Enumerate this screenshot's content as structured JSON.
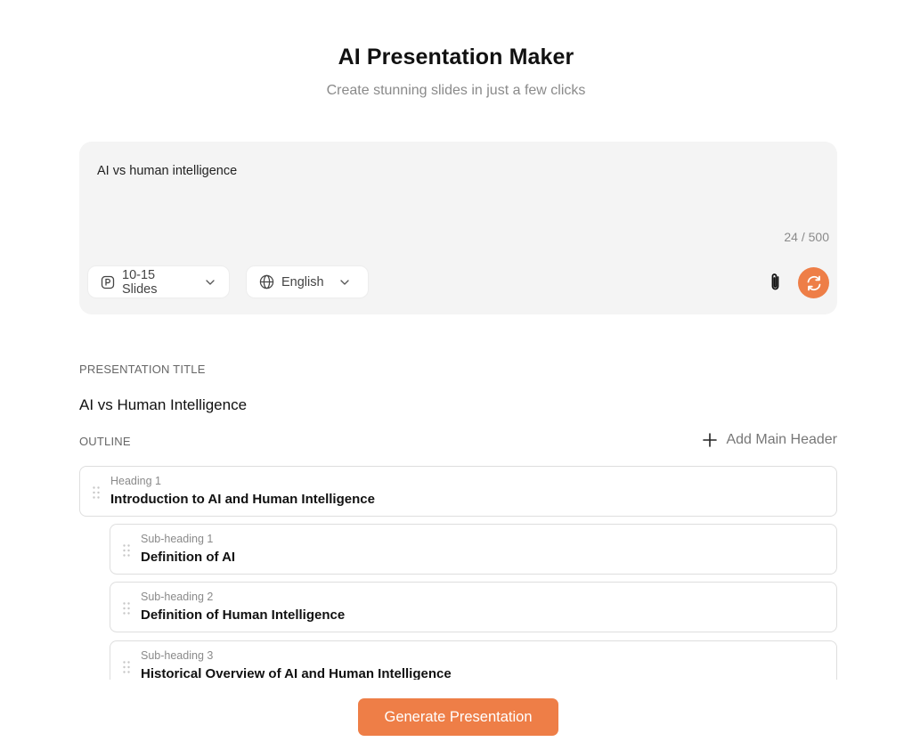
{
  "header": {
    "title": "AI Presentation Maker",
    "subtitle": "Create stunning slides in just a few clicks"
  },
  "prompt": {
    "value": "AI vs human intelligence",
    "char_count": "24 / 500",
    "slides_label": "10-15 Slides",
    "language_label": "English",
    "icons": {
      "slides": "presentation-p-icon",
      "language": "globe-icon",
      "dropdown": "chevron-down-icon",
      "attach": "paperclip-icon",
      "refresh": "refresh-icon"
    }
  },
  "presentation": {
    "title_label": "PRESENTATION TITLE",
    "title_value": "AI vs Human Intelligence"
  },
  "outline": {
    "label": "OUTLINE",
    "add_header_label": "Add Main Header",
    "items": [
      {
        "type": "heading",
        "label": "Heading 1",
        "text": "Introduction to AI and Human Intelligence"
      },
      {
        "type": "subheading",
        "label": "Sub-heading 1",
        "text": "Definition of AI"
      },
      {
        "type": "subheading",
        "label": "Sub-heading 2",
        "text": "Definition of Human Intelligence"
      },
      {
        "type": "subheading",
        "label": "Sub-heading 3",
        "text": "Historical Overview of AI and Human Intelligence"
      }
    ]
  },
  "actions": {
    "generate_label": "Generate Presentation"
  },
  "colors": {
    "accent": "#ee7e47",
    "card_bg": "#f4f4f4",
    "muted_text": "#8a8a8a"
  }
}
